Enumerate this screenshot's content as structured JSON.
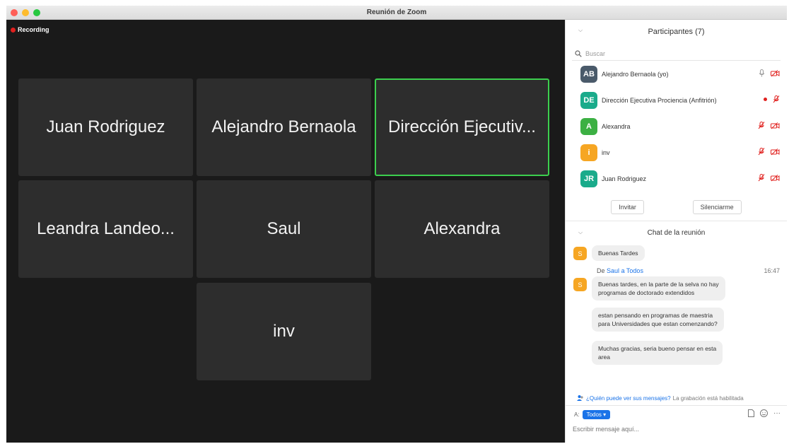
{
  "window": {
    "title": "Reunión de Zoom"
  },
  "recording": {
    "label": "Recording"
  },
  "tiles": [
    {
      "name": "Juan Rodriguez"
    },
    {
      "name": "Alejandro Bernaola"
    },
    {
      "name": "Dirección Ejecutiv..."
    },
    {
      "name": "Leandra Landeo..."
    },
    {
      "name": "Saul"
    },
    {
      "name": "Alexandra"
    },
    {
      "name": "inv"
    }
  ],
  "participants": {
    "header": "Participantes (7)",
    "search_placeholder": "Buscar",
    "list": [
      {
        "initials": "AB",
        "name": "Alejandro Bernaola (yo)",
        "color": "#4a5a6a"
      },
      {
        "initials": "DE",
        "name": "Dirección Ejecutiva Prociencia (Anfitrión)",
        "color": "#1aab8b"
      },
      {
        "initials": "A",
        "name": "Alexandra",
        "color": "#3cb043"
      },
      {
        "initials": "i",
        "name": "inv",
        "color": "#f6a623"
      },
      {
        "initials": "JR",
        "name": "Juan Rodriguez",
        "color": "#1aab8b"
      }
    ],
    "invite_label": "Invitar",
    "mute_label": "Silenciarme"
  },
  "chat": {
    "header": "Chat de la reunión",
    "sender_initial": "S",
    "msg1": "Buenas Tardes",
    "from_prefix": "De",
    "from_sender": "Saul",
    "from_connector": "a",
    "from_target": "Todos",
    "time": "16:47",
    "msg2_line1": "Buenas tardes, en la parte de la selva no hay",
    "msg2_line2": "programas de doctorado extendidos",
    "msg3_line1": "estan pensando en programas de maestria",
    "msg3_line2": "para Universidades que estan comenzando?",
    "msg4_line1": "Muchas gracias, seria bueno pensar en esta",
    "msg4_line2": "area",
    "notice_link": "¿Quién puede ver sus mensajes?",
    "notice_rest": "La grabación está habilitada",
    "to_prefix": "A:",
    "to_value": "Todos ▾",
    "input_placeholder": "Escribir mensaje aquí...",
    "more_label": "···"
  },
  "colors": {
    "active_border": "#3ccf4e",
    "accent": "#1a73e8",
    "muted_icon": "#e0201e"
  }
}
